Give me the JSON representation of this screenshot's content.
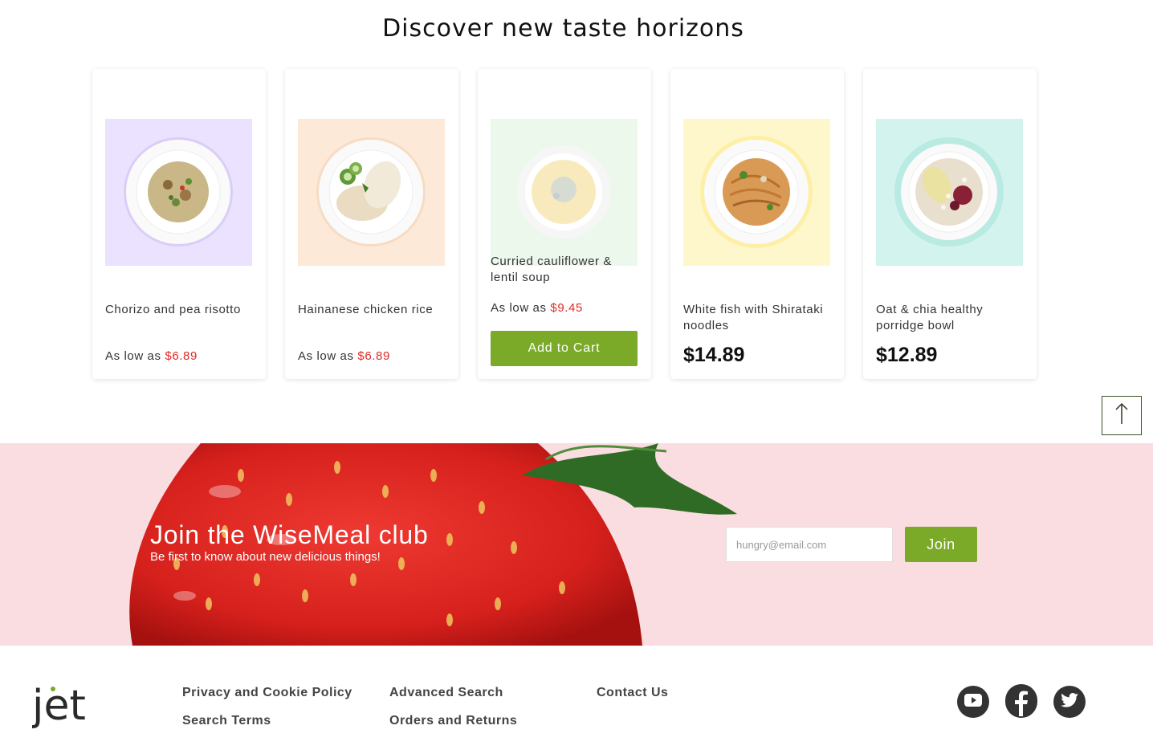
{
  "section": {
    "title": "Discover new taste horizons"
  },
  "products": [
    {
      "name": "Chorizo and pea risotto",
      "price_prefix": "As low as",
      "price": "$6.89",
      "bg_color": "#ebe2ff",
      "accent": "#9c8a4a"
    },
    {
      "name": "Hainanese chicken rice",
      "price_prefix": "As low as",
      "price": "$6.89",
      "bg_color": "#fde9d8",
      "accent": "#b9a88a"
    },
    {
      "name": "Curried cauliflower & lentil soup",
      "price_prefix": "As low as",
      "price": "$9.45",
      "cta": "Add to Cart",
      "bg_color": "#eef8ee",
      "accent": "#f3e2a8"
    },
    {
      "name": "White fish with Shirataki noodles",
      "price": "$14.89",
      "bg_color": "#fff7cc",
      "accent": "#c9843a"
    },
    {
      "name": "Oat & chia healthy porridge bowl",
      "price": "$12.89",
      "bg_color": "#d3f3ee",
      "accent": "#8a3040"
    }
  ],
  "back_to_top": {
    "icon": "arrow-up-icon"
  },
  "newsletter": {
    "title": "Join the WiseMeal club",
    "subtitle": "Be first to know about new delicious things!",
    "email_placeholder": "hungry@email.com",
    "join_label": "Join"
  },
  "footer": {
    "logo_text": "jet",
    "links": {
      "privacy": "Privacy and Cookie Policy",
      "search_terms": "Search Terms",
      "advanced_search": "Advanced Search",
      "orders_returns": "Orders and Returns",
      "contact": "Contact Us"
    },
    "social": [
      "youtube-icon",
      "facebook-icon",
      "twitter-icon"
    ]
  },
  "colors": {
    "accent_green": "#7ba928",
    "price_red": "#e02b27",
    "newsletter_bg": "#f9dde0",
    "strawberry_red": "#d6201c"
  }
}
